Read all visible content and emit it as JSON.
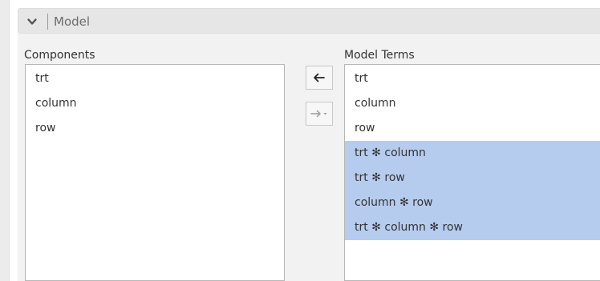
{
  "section": {
    "title": "Model",
    "icon": "chevron-down-icon"
  },
  "components": {
    "label": "Components",
    "items": [
      "trt",
      "column",
      "row"
    ]
  },
  "buttons": {
    "move_left_icon": "arrow-left-icon",
    "move_right_icon": "arrow-right-dropdown-icon"
  },
  "model_terms": {
    "label": "Model Terms",
    "items": [
      {
        "label": "trt",
        "selected": false
      },
      {
        "label": "column",
        "selected": false
      },
      {
        "label": "row",
        "selected": false
      },
      {
        "label": "trt ✻ column",
        "selected": true
      },
      {
        "label": "trt ✻ row",
        "selected": true
      },
      {
        "label": "column ✻ row",
        "selected": true
      },
      {
        "label": "trt ✻ column ✻ row",
        "selected": true
      }
    ]
  },
  "colors": {
    "selection": "#b6ccef",
    "panel_background": "#f2f2f2",
    "header_background": "#e6e6e6"
  }
}
